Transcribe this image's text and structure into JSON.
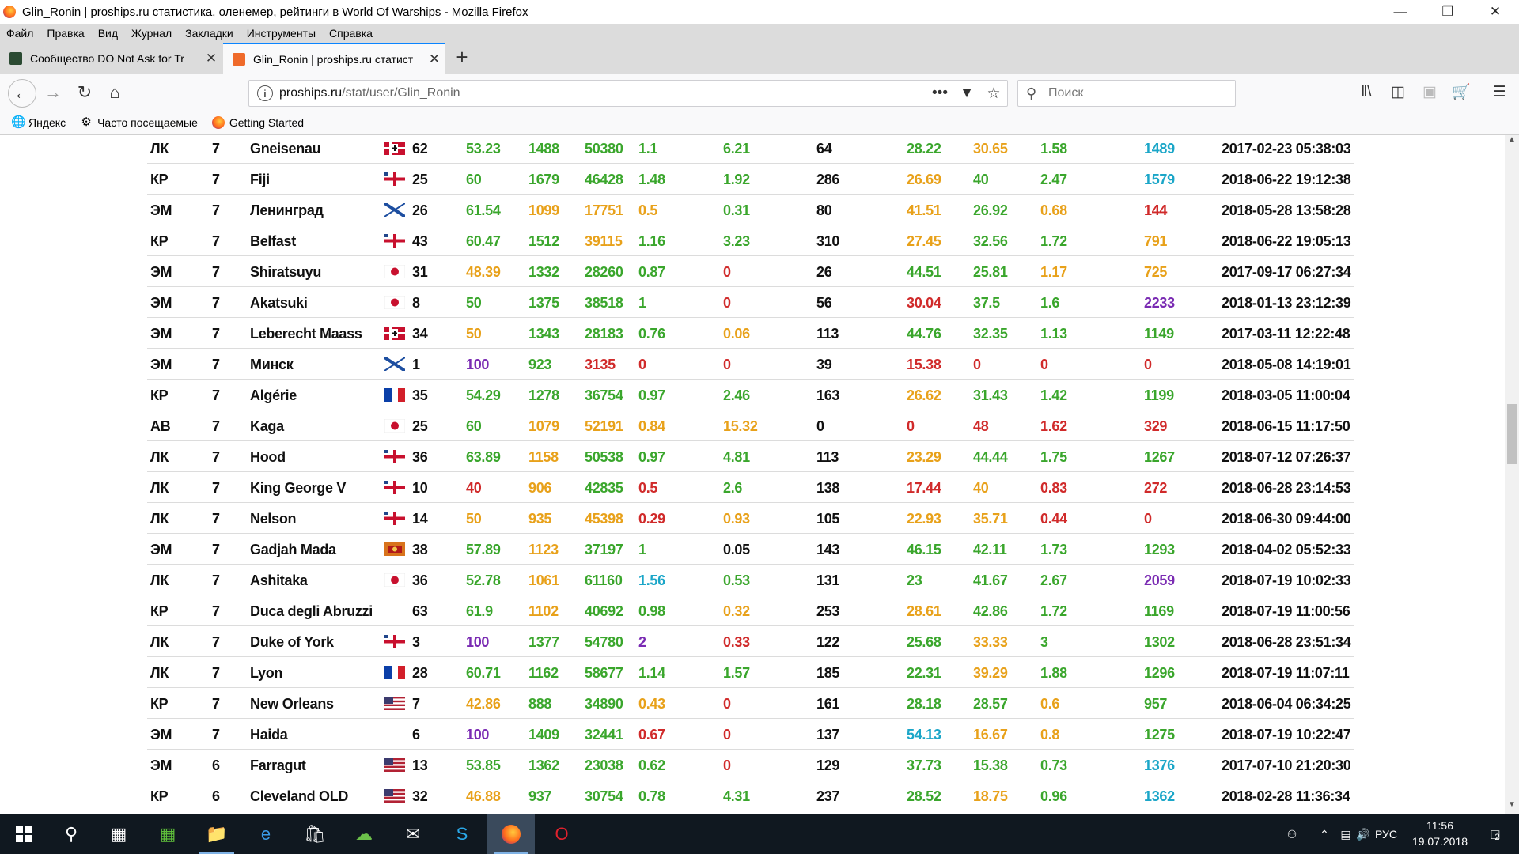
{
  "window": {
    "title": "Glin_Ronin | proships.ru статистика, оленемер, рейтинги в World Of Warships - Mozilla Firefox"
  },
  "menu": [
    "Файл",
    "Правка",
    "Вид",
    "Журнал",
    "Закладки",
    "Инструменты",
    "Справка"
  ],
  "tabs": [
    {
      "label": "Сообщество DO Not Ask for Tr"
    },
    {
      "label": "Glin_Ronin | proships.ru статист"
    }
  ],
  "url": {
    "domain": "proships.ru",
    "path": "/stat/user/Glin_Ronin"
  },
  "search": {
    "placeholder": "Поиск"
  },
  "bookmarks": [
    "Яндекс",
    "Часто посещаемые",
    "Getting Started"
  ],
  "colors": {
    "green": "#3aa62c",
    "orange": "#e8a11a",
    "red": "#d02a2a",
    "blue": "#1ba6c8",
    "purple": "#7a2bb3",
    "black": "#111111"
  },
  "ships": [
    {
      "type": "ЛК",
      "tier": "7",
      "name": "Gneisenau",
      "flag": "de",
      "battles": "62",
      "v": [
        [
          "53.23",
          "g"
        ],
        [
          "1488",
          "g"
        ],
        [
          "50380",
          "g"
        ],
        [
          "1.1",
          "g"
        ],
        [
          "6.21",
          "g"
        ],
        [
          "64",
          "k"
        ],
        [
          "28.22",
          "g"
        ],
        [
          "30.65",
          "o"
        ],
        [
          "1.58",
          "g"
        ],
        [
          "1489",
          "b"
        ]
      ],
      "date": "2017-02-23 05:38:03"
    },
    {
      "type": "КР",
      "tier": "7",
      "name": "Fiji",
      "flag": "uk",
      "battles": "25",
      "v": [
        [
          "60",
          "g"
        ],
        [
          "1679",
          "g"
        ],
        [
          "46428",
          "g"
        ],
        [
          "1.48",
          "g"
        ],
        [
          "1.92",
          "g"
        ],
        [
          "286",
          "k"
        ],
        [
          "26.69",
          "o"
        ],
        [
          "40",
          "g"
        ],
        [
          "2.47",
          "g"
        ],
        [
          "1579",
          "b"
        ]
      ],
      "date": "2018-06-22 19:12:38"
    },
    {
      "type": "ЭМ",
      "tier": "7",
      "name": "Ленинград",
      "flag": "ru",
      "battles": "26",
      "v": [
        [
          "61.54",
          "g"
        ],
        [
          "1099",
          "o"
        ],
        [
          "17751",
          "o"
        ],
        [
          "0.5",
          "o"
        ],
        [
          "0.31",
          "g"
        ],
        [
          "80",
          "k"
        ],
        [
          "41.51",
          "o"
        ],
        [
          "26.92",
          "g"
        ],
        [
          "0.68",
          "o"
        ],
        [
          "144",
          "r"
        ]
      ],
      "date": "2018-05-28 13:58:28"
    },
    {
      "type": "КР",
      "tier": "7",
      "name": "Belfast",
      "flag": "uk",
      "battles": "43",
      "v": [
        [
          "60.47",
          "g"
        ],
        [
          "1512",
          "g"
        ],
        [
          "39115",
          "o"
        ],
        [
          "1.16",
          "g"
        ],
        [
          "3.23",
          "g"
        ],
        [
          "310",
          "k"
        ],
        [
          "27.45",
          "o"
        ],
        [
          "32.56",
          "g"
        ],
        [
          "1.72",
          "g"
        ],
        [
          "791",
          "o"
        ]
      ],
      "date": "2018-06-22 19:05:13"
    },
    {
      "type": "ЭМ",
      "tier": "7",
      "name": "Shiratsuyu",
      "flag": "jp",
      "battles": "31",
      "v": [
        [
          "48.39",
          "o"
        ],
        [
          "1332",
          "g"
        ],
        [
          "28260",
          "g"
        ],
        [
          "0.87",
          "g"
        ],
        [
          "0",
          "r"
        ],
        [
          "26",
          "k"
        ],
        [
          "44.51",
          "g"
        ],
        [
          "25.81",
          "g"
        ],
        [
          "1.17",
          "o"
        ],
        [
          "725",
          "o"
        ]
      ],
      "date": "2017-09-17 06:27:34"
    },
    {
      "type": "ЭМ",
      "tier": "7",
      "name": "Akatsuki",
      "flag": "jp",
      "battles": "8",
      "v": [
        [
          "50",
          "g"
        ],
        [
          "1375",
          "g"
        ],
        [
          "38518",
          "g"
        ],
        [
          "1",
          "g"
        ],
        [
          "0",
          "r"
        ],
        [
          "56",
          "k"
        ],
        [
          "30.04",
          "r"
        ],
        [
          "37.5",
          "g"
        ],
        [
          "1.6",
          "g"
        ],
        [
          "2233",
          "p"
        ]
      ],
      "date": "2018-01-13 23:12:39"
    },
    {
      "type": "ЭМ",
      "tier": "7",
      "name": "Leberecht Maass",
      "flag": "de",
      "battles": "34",
      "v": [
        [
          "50",
          "o"
        ],
        [
          "1343",
          "g"
        ],
        [
          "28183",
          "g"
        ],
        [
          "0.76",
          "g"
        ],
        [
          "0.06",
          "o"
        ],
        [
          "113",
          "k"
        ],
        [
          "44.76",
          "g"
        ],
        [
          "32.35",
          "g"
        ],
        [
          "1.13",
          "g"
        ],
        [
          "1149",
          "g"
        ]
      ],
      "date": "2017-03-11 12:22:48"
    },
    {
      "type": "ЭМ",
      "tier": "7",
      "name": "Минск",
      "flag": "ru",
      "battles": "1",
      "v": [
        [
          "100",
          "p"
        ],
        [
          "923",
          "g"
        ],
        [
          "3135",
          "r"
        ],
        [
          "0",
          "r"
        ],
        [
          "0",
          "r"
        ],
        [
          "39",
          "k"
        ],
        [
          "15.38",
          "r"
        ],
        [
          "0",
          "r"
        ],
        [
          "0",
          "r"
        ],
        [
          "0",
          "r"
        ]
      ],
      "date": "2018-05-08 14:19:01"
    },
    {
      "type": "КР",
      "tier": "7",
      "name": "Algérie",
      "flag": "fr",
      "battles": "35",
      "v": [
        [
          "54.29",
          "g"
        ],
        [
          "1278",
          "g"
        ],
        [
          "36754",
          "g"
        ],
        [
          "0.97",
          "g"
        ],
        [
          "2.46",
          "g"
        ],
        [
          "163",
          "k"
        ],
        [
          "26.62",
          "o"
        ],
        [
          "31.43",
          "g"
        ],
        [
          "1.42",
          "g"
        ],
        [
          "1199",
          "g"
        ]
      ],
      "date": "2018-03-05 11:00:04"
    },
    {
      "type": "АВ",
      "tier": "7",
      "name": "Kaga",
      "flag": "jp",
      "battles": "25",
      "v": [
        [
          "60",
          "g"
        ],
        [
          "1079",
          "o"
        ],
        [
          "52191",
          "o"
        ],
        [
          "0.84",
          "o"
        ],
        [
          "15.32",
          "o"
        ],
        [
          "0",
          "k"
        ],
        [
          "0",
          "r"
        ],
        [
          "48",
          "r"
        ],
        [
          "1.62",
          "r"
        ],
        [
          "329",
          "r"
        ]
      ],
      "date": "2018-06-15 11:17:50"
    },
    {
      "type": "ЛК",
      "tier": "7",
      "name": "Hood",
      "flag": "uk",
      "battles": "36",
      "v": [
        [
          "63.89",
          "g"
        ],
        [
          "1158",
          "o"
        ],
        [
          "50538",
          "g"
        ],
        [
          "0.97",
          "g"
        ],
        [
          "4.81",
          "g"
        ],
        [
          "113",
          "k"
        ],
        [
          "23.29",
          "o"
        ],
        [
          "44.44",
          "g"
        ],
        [
          "1.75",
          "g"
        ],
        [
          "1267",
          "g"
        ]
      ],
      "date": "2018-07-12 07:26:37"
    },
    {
      "type": "ЛК",
      "tier": "7",
      "name": "King George V",
      "flag": "uk",
      "battles": "10",
      "v": [
        [
          "40",
          "r"
        ],
        [
          "906",
          "o"
        ],
        [
          "42835",
          "g"
        ],
        [
          "0.5",
          "r"
        ],
        [
          "2.6",
          "g"
        ],
        [
          "138",
          "k"
        ],
        [
          "17.44",
          "r"
        ],
        [
          "40",
          "o"
        ],
        [
          "0.83",
          "r"
        ],
        [
          "272",
          "r"
        ]
      ],
      "date": "2018-06-28 23:14:53"
    },
    {
      "type": "ЛК",
      "tier": "7",
      "name": "Nelson",
      "flag": "uk",
      "battles": "14",
      "v": [
        [
          "50",
          "o"
        ],
        [
          "935",
          "o"
        ],
        [
          "45398",
          "o"
        ],
        [
          "0.29",
          "r"
        ],
        [
          "0.93",
          "o"
        ],
        [
          "105",
          "k"
        ],
        [
          "22.93",
          "o"
        ],
        [
          "35.71",
          "o"
        ],
        [
          "0.44",
          "r"
        ],
        [
          "0",
          "r"
        ]
      ],
      "date": "2018-06-30 09:44:00"
    },
    {
      "type": "ЭМ",
      "tier": "7",
      "name": "Gadjah Mada",
      "flag": "pa",
      "battles": "38",
      "v": [
        [
          "57.89",
          "g"
        ],
        [
          "1123",
          "o"
        ],
        [
          "37197",
          "g"
        ],
        [
          "1",
          "g"
        ],
        [
          "0.05",
          "k"
        ],
        [
          "143",
          "k"
        ],
        [
          "46.15",
          "g"
        ],
        [
          "42.11",
          "g"
        ],
        [
          "1.73",
          "g"
        ],
        [
          "1293",
          "g"
        ]
      ],
      "date": "2018-04-02 05:52:33"
    },
    {
      "type": "ЛК",
      "tier": "7",
      "name": "Ashitaka",
      "flag": "jp",
      "battles": "36",
      "v": [
        [
          "52.78",
          "g"
        ],
        [
          "1061",
          "o"
        ],
        [
          "61160",
          "g"
        ],
        [
          "1.56",
          "b"
        ],
        [
          "0.53",
          "g"
        ],
        [
          "131",
          "k"
        ],
        [
          "23",
          "g"
        ],
        [
          "41.67",
          "g"
        ],
        [
          "2.67",
          "g"
        ],
        [
          "2059",
          "p"
        ]
      ],
      "date": "2018-07-19 10:02:33"
    },
    {
      "type": "КР",
      "tier": "7",
      "name": "Duca degli Abruzzi",
      "flag": "",
      "battles": "63",
      "v": [
        [
          "61.9",
          "g"
        ],
        [
          "1102",
          "o"
        ],
        [
          "40692",
          "g"
        ],
        [
          "0.98",
          "g"
        ],
        [
          "0.32",
          "o"
        ],
        [
          "253",
          "k"
        ],
        [
          "28.61",
          "o"
        ],
        [
          "42.86",
          "g"
        ],
        [
          "1.72",
          "g"
        ],
        [
          "1169",
          "g"
        ]
      ],
      "date": "2018-07-19 11:00:56"
    },
    {
      "type": "ЛК",
      "tier": "7",
      "name": "Duke of York",
      "flag": "uk",
      "battles": "3",
      "v": [
        [
          "100",
          "p"
        ],
        [
          "1377",
          "g"
        ],
        [
          "54780",
          "g"
        ],
        [
          "2",
          "p"
        ],
        [
          "0.33",
          "r"
        ],
        [
          "122",
          "k"
        ],
        [
          "25.68",
          "g"
        ],
        [
          "33.33",
          "o"
        ],
        [
          "3",
          "g"
        ],
        [
          "1302",
          "g"
        ]
      ],
      "date": "2018-06-28 23:51:34"
    },
    {
      "type": "ЛК",
      "tier": "7",
      "name": "Lyon",
      "flag": "fr",
      "battles": "28",
      "v": [
        [
          "60.71",
          "g"
        ],
        [
          "1162",
          "g"
        ],
        [
          "58677",
          "g"
        ],
        [
          "1.14",
          "g"
        ],
        [
          "1.57",
          "g"
        ],
        [
          "185",
          "k"
        ],
        [
          "22.31",
          "g"
        ],
        [
          "39.29",
          "o"
        ],
        [
          "1.88",
          "g"
        ],
        [
          "1296",
          "g"
        ]
      ],
      "date": "2018-07-19 11:07:11"
    },
    {
      "type": "КР",
      "tier": "7",
      "name": "New Orleans",
      "flag": "us",
      "battles": "7",
      "v": [
        [
          "42.86",
          "o"
        ],
        [
          "888",
          "g"
        ],
        [
          "34890",
          "g"
        ],
        [
          "0.43",
          "o"
        ],
        [
          "0",
          "r"
        ],
        [
          "161",
          "k"
        ],
        [
          "28.18",
          "g"
        ],
        [
          "28.57",
          "g"
        ],
        [
          "0.6",
          "o"
        ],
        [
          "957",
          "g"
        ]
      ],
      "date": "2018-06-04 06:34:25"
    },
    {
      "type": "ЭМ",
      "tier": "7",
      "name": "Haida",
      "flag": "",
      "battles": "6",
      "v": [
        [
          "100",
          "p"
        ],
        [
          "1409",
          "g"
        ],
        [
          "32441",
          "g"
        ],
        [
          "0.67",
          "r"
        ],
        [
          "0",
          "r"
        ],
        [
          "137",
          "k"
        ],
        [
          "54.13",
          "b"
        ],
        [
          "16.67",
          "o"
        ],
        [
          "0.8",
          "o"
        ],
        [
          "1275",
          "g"
        ]
      ],
      "date": "2018-07-19 10:22:47"
    },
    {
      "type": "ЭМ",
      "tier": "6",
      "name": "Farragut",
      "flag": "us",
      "battles": "13",
      "v": [
        [
          "53.85",
          "g"
        ],
        [
          "1362",
          "g"
        ],
        [
          "23038",
          "g"
        ],
        [
          "0.62",
          "g"
        ],
        [
          "0",
          "r"
        ],
        [
          "129",
          "k"
        ],
        [
          "37.73",
          "g"
        ],
        [
          "15.38",
          "g"
        ],
        [
          "0.73",
          "g"
        ],
        [
          "1376",
          "b"
        ]
      ],
      "date": "2017-07-10 21:20:30"
    },
    {
      "type": "КР",
      "tier": "6",
      "name": "Cleveland OLD",
      "flag": "us",
      "battles": "32",
      "v": [
        [
          "46.88",
          "o"
        ],
        [
          "937",
          "g"
        ],
        [
          "30754",
          "g"
        ],
        [
          "0.78",
          "g"
        ],
        [
          "4.31",
          "g"
        ],
        [
          "237",
          "k"
        ],
        [
          "28.52",
          "g"
        ],
        [
          "18.75",
          "o"
        ],
        [
          "0.96",
          "g"
        ],
        [
          "1362",
          "b"
        ]
      ],
      "date": "2018-02-28 11:36:34"
    }
  ],
  "tray": {
    "lang": "РУС",
    "time": "11:56",
    "date": "19.07.2018",
    "notifications": "2"
  }
}
